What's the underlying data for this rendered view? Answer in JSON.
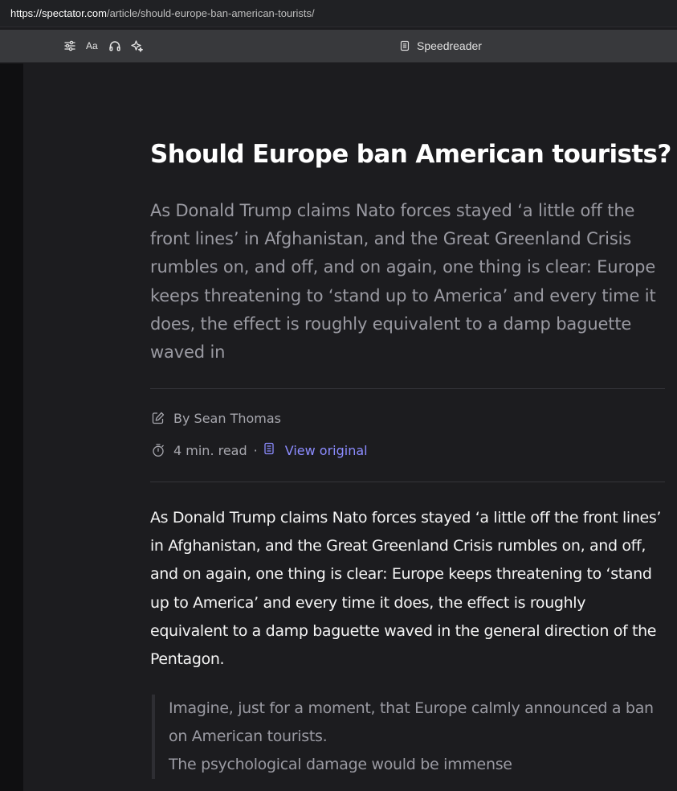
{
  "browser": {
    "url_host": "https://spectator.com",
    "url_path": "/article/should-europe-ban-american-tourists/"
  },
  "toolbar": {
    "font_label": "Aa",
    "speedreader_label": "Speedreader"
  },
  "article": {
    "title": "Should Europe ban American tourists?",
    "lede": "As Donald Trump claims Nato forces stayed ‘a little off the front lines’ in Afghanistan, and the Great Greenland Crisis rumbles on, and off, and on again, one thing is clear: Europe keeps threatening to ‘stand up to America’ and every time it does, the effect is roughly equivalent to a damp baguette waved in",
    "byline": "By Sean Thomas",
    "read_time": "4 min. read",
    "separator": "·",
    "view_original": "View original",
    "body": "As Donald Trump claims Nato forces stayed ‘a little off the front lines’ in Afghanistan, and the Great Greenland Crisis rumbles on, and off, and on again, one thing is clear: Europe keeps threatening to ‘stand up to America’ and every time it does, the effect is roughly equivalent to a damp baguette waved in the general direction of the Pentagon.",
    "quote_line1": "Imagine, just for a moment, that Europe calmly announced a ban on American tourists.",
    "quote_line2": "The psychological damage would be immense"
  },
  "colors": {
    "background": "#1c1c1f",
    "toolbar": "#38393c",
    "link": "#8c8cff",
    "muted_text": "#9a9aa2"
  }
}
